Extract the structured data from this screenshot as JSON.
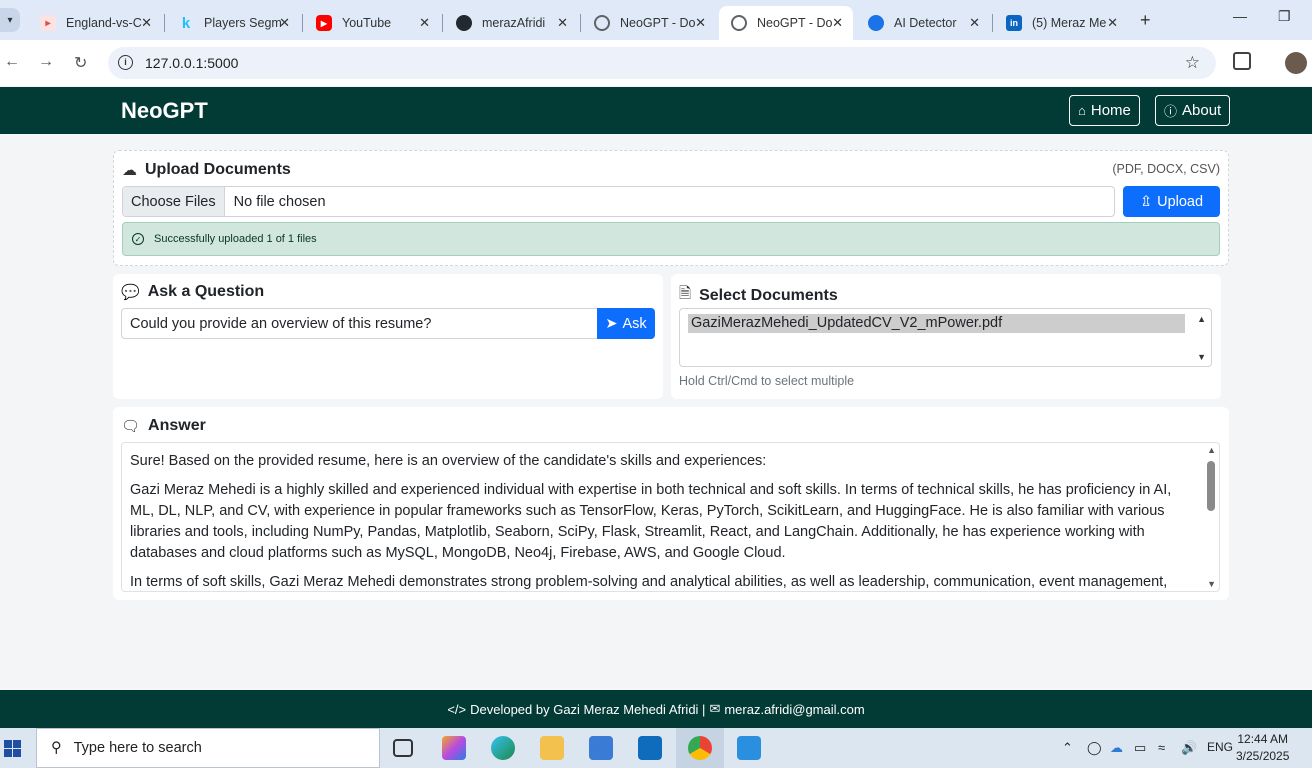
{
  "browser": {
    "tabs": [
      {
        "title": "England-vs-C",
        "icon": "pdf-favicon",
        "color": "#e34c4c"
      },
      {
        "title": "Players Segm",
        "icon": "kaggle-favicon",
        "color": "#20beff"
      },
      {
        "title": "YouTube",
        "icon": "youtube-favicon",
        "color": "#ff0000"
      },
      {
        "title": "merazAfridi",
        "icon": "github-favicon",
        "color": "#24292f"
      },
      {
        "title": "NeoGPT - Do",
        "icon": "globe-favicon",
        "color": "#5f6368"
      },
      {
        "title": "NeoGPT - Do",
        "icon": "globe-favicon",
        "color": "#5f6368"
      },
      {
        "title": "AI Detector",
        "icon": "ai-detector-favicon",
        "color": "#1a73e8"
      },
      {
        "title": "(5) Meraz Me",
        "icon": "linkedin-favicon",
        "color": "#0a66c2"
      }
    ],
    "url": "127.0.0.1:5000"
  },
  "navbar": {
    "brand": "NeoGPT",
    "home_label": "Home",
    "about_label": "About"
  },
  "upload": {
    "title": "Upload Documents",
    "formats": "(PDF, DOCX, CSV)",
    "choose_label": "Choose Files",
    "file_status": "No file chosen",
    "button_label": "Upload",
    "alert": "Successfully uploaded 1 of 1 files"
  },
  "ask": {
    "title": "Ask a Question",
    "question": "Could you provide an overview of this resume?",
    "button_label": "Ask"
  },
  "select": {
    "title": "Select Documents",
    "options": [
      "GaziMerazMehedi_UpdatedCV_V2_mPower.pdf"
    ],
    "hint": "Hold Ctrl/Cmd to select multiple"
  },
  "answer": {
    "title": "Answer",
    "paragraphs": [
      "Sure! Based on the provided resume, here is an overview of the candidate's skills and experiences:",
      "Gazi Meraz Mehedi is a highly skilled and experienced individual with expertise in both technical and soft skills. In terms of technical skills, he has proficiency in AI, ML, DL, NLP, and CV, with experience in popular frameworks such as TensorFlow, Keras, PyTorch, ScikitLearn, and HuggingFace. He is also familiar with various libraries and tools, including NumPy, Pandas, Matplotlib, Seaborn, SciPy, Flask, Streamlit, React, and LangChain. Additionally, he has experience working with databases and cloud platforms such as MySQL, MongoDB, Neo4j, Firebase, AWS, and Google Cloud.",
      "In terms of soft skills, Gazi Meraz Mehedi demonstrates strong problem-solving and analytical abilities, as well as leadership, communication, event management, and"
    ]
  },
  "footer": {
    "developer": "Developed by Gazi Meraz Mehedi Afridi |",
    "email": "meraz.afridi@gmail.com"
  },
  "taskbar": {
    "search_placeholder": "Type here to search",
    "language": "ENG",
    "time": "12:44 AM",
    "date": "3/25/2025"
  }
}
